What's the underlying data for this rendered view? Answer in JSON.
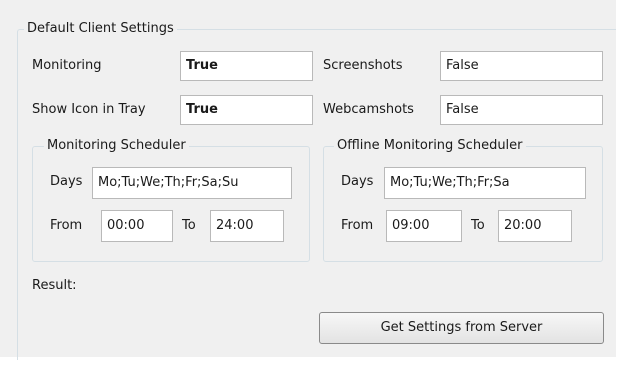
{
  "group": {
    "title": "Default Client Settings"
  },
  "monitoring": {
    "label": "Monitoring",
    "value": "True"
  },
  "screenshots": {
    "label": "Screenshots",
    "value": "False"
  },
  "tray": {
    "label": "Show Icon in Tray",
    "value": "True"
  },
  "webcam": {
    "label": "Webcamshots",
    "value": "False"
  },
  "scheduler": {
    "title": "Monitoring Scheduler",
    "days_label": "Days",
    "days": "Mo;Tu;We;Th;Fr;Sa;Su",
    "from_label": "From",
    "from": "00:00",
    "to_label": "To",
    "to": "24:00"
  },
  "offline": {
    "title": "Offline Monitoring Scheduler",
    "days_label": "Days",
    "days": "Mo;Tu;We;Th;Fr;Sa",
    "from_label": "From",
    "from": "09:00",
    "to_label": "To",
    "to": "20:00"
  },
  "result_label": "Result:",
  "get_button": "Get Settings from Server"
}
